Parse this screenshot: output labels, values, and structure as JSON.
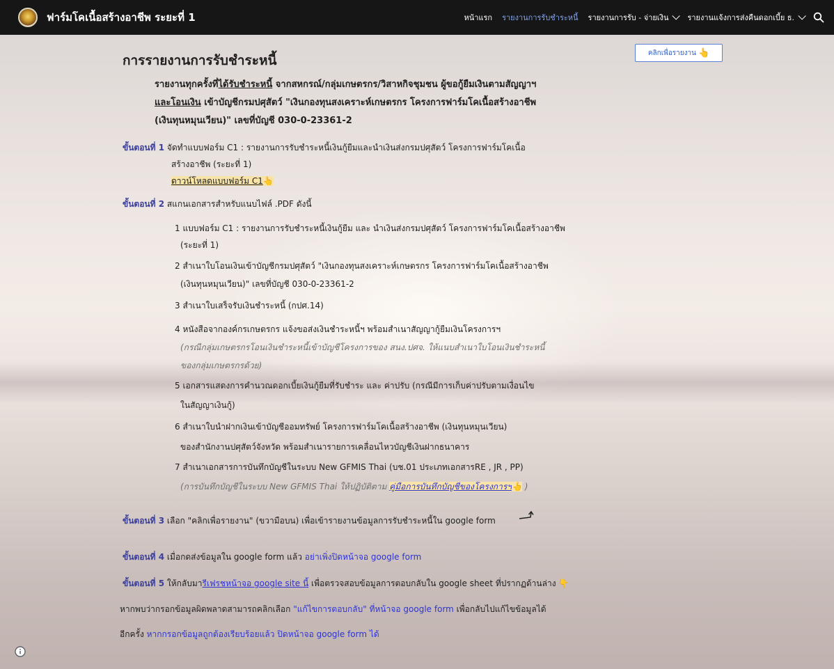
{
  "header": {
    "site_title": "ฟาร์มโคเนื้อสร้างอาชีพ ระยะที่ 1",
    "nav": [
      {
        "label": "หน้าแรก"
      },
      {
        "label": "รายงานการรับชำระหนี้"
      },
      {
        "label": "รายงานการรับ - จ่ายเงิน"
      },
      {
        "label": "รายงานแจ้งการส่งคืนดอกเบี้ย ธ."
      }
    ]
  },
  "report_button": {
    "label": "คลิกเพื่อรายงาน",
    "icon": "👆"
  },
  "page": {
    "title": "การรายงานการรับชำระหนี้",
    "intro_line1_a": "รายงานทุกครั้งที่",
    "intro_line1_b": "ได้รับชำระหนี้",
    "intro_line1_c": " จากสหกรณ์/กลุ่มเกษตรกร/วิสาหกิจชุมชน ผู้ขอกู้ยืมเงินตามสัญญาฯ",
    "intro_line2_a": "และโอนเงิน",
    "intro_line2_b": " เข้าบัญชีกรมปศุสัตว์ \"เงินกองทุนสงเคราะห์เกษตรกร โครงการฟาร์มโคเนื้อสร้างอาชีพ",
    "intro_line3": "(เงินทุนหมุนเวียน)\" เลขที่บัญชี  030-0-23361-2"
  },
  "steps": {
    "s1_label": "ขั้นตอนที่ 1",
    "s1_text": " จัดทำแบบฟอร์ม C1 : รายงานการรับชำระหนี้เงินกู้ยืมและนำเงินส่งกรมปศุสัตว์ โครงการฟาร์มโคเนื้อ",
    "s1_text2": "สร้างอาชีพ (ระยะที่ 1)",
    "s1_link": "ดาวน์โหลดแบบฟอร์ม C1",
    "s2_label": "ขั้นตอนที่ 2",
    "s2_text": " สแกนเอกสารสำหรับแนบไฟล์ .PDF ดังนี้",
    "items": [
      "1 แบบฟอร์ม C1 : รายงานการรับชำระหนี้เงินกู้ยืม และ นำเงินส่งกรมปศุสัตว์  โครงการฟาร์มโคเนื้อสร้างอาชีพ",
      "(ระยะที่ 1)",
      "2 สำเนาใบโอนเงินเข้าบัญชีกรมปศุสัตว์ \"เงินกองทุนสงเคราะห์เกษตรกร โครงการฟาร์มโคเนื้อสร้างอาชีพ",
      "(เงินทุนหมุนเวียน)\"   เลขที่บัญชี  030-0-23361-2",
      "3 สำเนาใบเสร็จรับเงินชำระหนี้ (กปศ.14)",
      "4 หนังสือจากองค์กรเกษตรกร แจ้งขอส่งเงินชำระหนี้ฯ พร้อมสำเนาสัญญากู้ยืมเงินโครงการฯ",
      "(กรณีกลุ่มเกษตรกรโอนเงินชำระหนี้เข้าบัญชีโครงการของ สนง.ปศจ. ให้แนบสำเนาใบโอนเงินชำระหนี้",
      "ของกลุ่มเกษตรกรด้วย)",
      "5 เอกสารแสดงการคำนวณดอกเบี้ยเงินกู้ยืมที่รับชำระ และ ค่าปรับ (กรณีมีการเก็บค่าปรับตามเงื่อนไข",
      "ในสัญญาเงินกู้)",
      "6 สำเนาใบนำฝากเงินเข้าบัญชีออมทรัพย์ โครงการฟาร์มโคเนื้อสร้างอาชีพ (เงินทุนหมุนเวียน)",
      "ของสำนักงานปศุสัตว์จังหวัด  พร้อมสำเนารายการเคลื่อนไหวบัญชีเงินฝากธนาคาร",
      "7 สำเนาเอกสารการบันทึกบัญชีในระบบ New GFMIS Thai (บช.01 ประเภทเอกสารRE , JR , PP)",
      "(การบันทึกบัญชีในระบบ New GFMIS Thai ให้ปฏิบัติตาม ",
      "คู่มือการบันทึกบัญชีของโครงการฯ",
      " )"
    ],
    "s3_label": "ขั้นตอนที่ 3",
    "s3_text": " เลือก \"คลิกเพื่อรายงาน\" (ขวามือบน) เพื่อเข้ารายงานข้อมูลการรับชำระหนี้ใน google form",
    "s4_label": "ขั้นตอนที่ 4",
    "s4_text": "  เมื่อกดส่งข้อมูลใน google form แล้ว ",
    "s4_blue": "อย่าเพิ่งปิดหน้าจอ google form",
    "s5_label": "ขั้นตอนที่ 5",
    "s5_text_a": "  ให้กลับมา",
    "s5_link": "รีเฟรชหน้าจอ google site นี้",
    "s5_text_b": " เพื่อตรวจสอบข้อมูลการตอบกลับใน google sheet ที่ปรากฏด้านล่าง",
    "f1_a": "หากพบว่ากรอกข้อมูลผิดพลาดสามารถคลิกเลือก ",
    "f1_blue": "\"แก้ไขการตอบกลับ\" ที่หน้าจอ google form",
    "f1_b": " เพื่อกลับไปแก้ไขข้อมูลได้",
    "f2_a": "อีกครั้ง  ",
    "f2_blue": "หากกรอกข้อมูลถูกต้องเรียบร้อยแล้ว ปิดหน้าจอ google form ได้"
  }
}
